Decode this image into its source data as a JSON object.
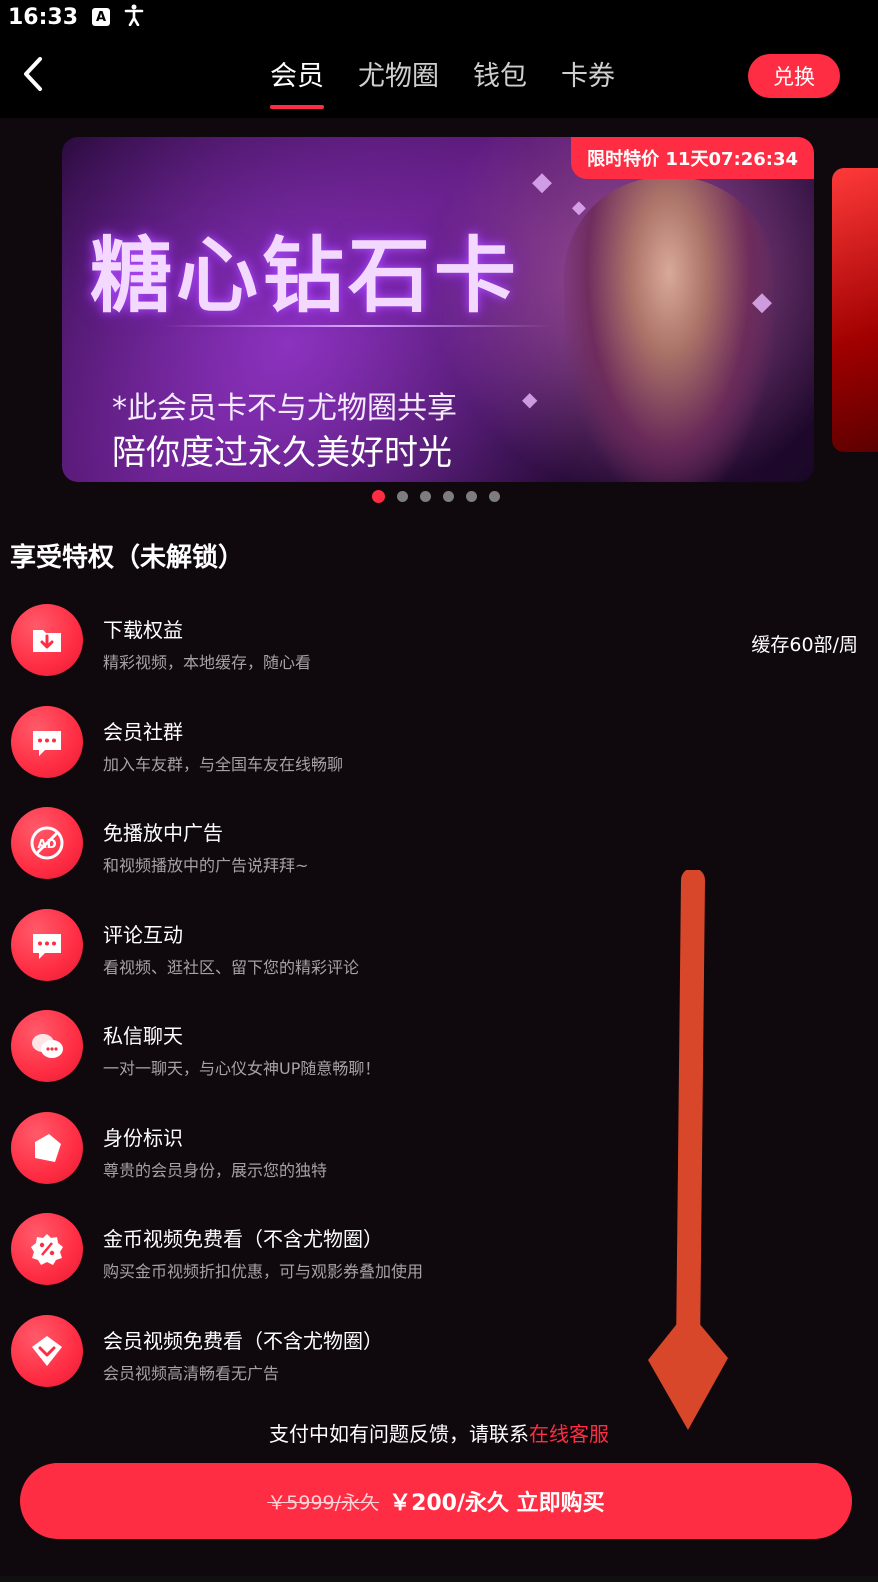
{
  "status": {
    "time": "16:33",
    "icons": [
      "a-box-icon",
      "accessibility-icon"
    ]
  },
  "nav": {
    "back_icon": "chevron-left-icon",
    "tabs": [
      {
        "label": "会员",
        "active": true
      },
      {
        "label": "尤物圈",
        "active": false
      },
      {
        "label": "钱包",
        "active": false
      },
      {
        "label": "卡券",
        "active": false
      }
    ],
    "redeem_label": "兑换"
  },
  "banner": {
    "promo_text": "限时特价 11天07:26:34",
    "title": "糖心钻石卡",
    "line1": "*此会员卡不与尤物圈共享",
    "line2": "陪你度过永久美好时光",
    "dots": {
      "count": 6,
      "active_index": 0
    }
  },
  "section_title": "享受特权（未解锁）",
  "privileges": [
    {
      "icon": "download-folder-icon",
      "title": "下载权益",
      "desc": "精彩视频，本地缓存，随心看",
      "right": "缓存60部/周"
    },
    {
      "icon": "chat-bubble-icon",
      "title": "会员社群",
      "desc": "加入车友群，与全国车友在线畅聊",
      "right": ""
    },
    {
      "icon": "no-ad-icon",
      "title": "免播放中广告",
      "desc": "和视频播放中的广告说拜拜~",
      "right": ""
    },
    {
      "icon": "comment-icon",
      "title": "评论互动",
      "desc": "看视频、逛社区、留下您的精彩评论",
      "right": ""
    },
    {
      "icon": "private-chat-icon",
      "title": "私信聊天",
      "desc": "一对一聊天，与心仪女神UP随意畅聊！",
      "right": ""
    },
    {
      "icon": "badge-icon",
      "title": "身份标识",
      "desc": "尊贵的会员身份，展示您的独特",
      "right": ""
    },
    {
      "icon": "discount-icon",
      "title": "金币视频免费看（不含尤物圈）",
      "desc": "购买金币视频折扣优惠，可与观影券叠加使用",
      "right": ""
    },
    {
      "icon": "diamond-icon",
      "title": "会员视频免费看（不含尤物圈）",
      "desc": "会员视频高清畅看无广告",
      "right": ""
    }
  ],
  "support": {
    "text": "支付中如有问题反馈，请联系",
    "link": "在线客服"
  },
  "buy": {
    "old_price": "￥5999/永久",
    "new_price": "￥200/永久 立即购买"
  },
  "colors": {
    "accent": "#ff2d43",
    "background": "#0f080c",
    "annotation_arrow": "#d9472b"
  }
}
